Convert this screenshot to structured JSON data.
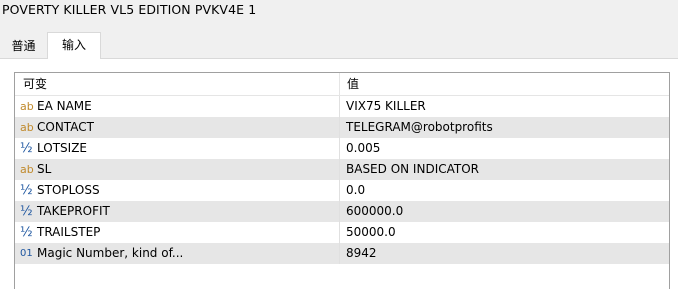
{
  "window": {
    "title": "POVERTY KILLER VL5 EDITION PVKV4E 1"
  },
  "tabs": [
    {
      "label": "普通",
      "active": false
    },
    {
      "label": "输入",
      "active": true
    }
  ],
  "table": {
    "headers": {
      "variable": "可变",
      "value": "值"
    },
    "rows": [
      {
        "icon": "ab",
        "icon_name": "string-type-icon",
        "name": "EA NAME",
        "value": "VIX75 KILLER"
      },
      {
        "icon": "ab",
        "icon_name": "string-type-icon",
        "name": "CONTACT",
        "value": "TELEGRAM@robotprofits"
      },
      {
        "icon": "½",
        "icon_name": "double-type-icon",
        "name": "LOTSIZE",
        "value": "0.005"
      },
      {
        "icon": "ab",
        "icon_name": "string-type-icon",
        "name": "SL",
        "value": "BASED ON INDICATOR"
      },
      {
        "icon": "½",
        "icon_name": "double-type-icon",
        "name": "STOPLOSS",
        "value": "0.0"
      },
      {
        "icon": "½",
        "icon_name": "double-type-icon",
        "name": "TAKEPROFIT",
        "value": "600000.0"
      },
      {
        "icon": "½",
        "icon_name": "double-type-icon",
        "name": "TRAILSTEP",
        "value": "50000.0"
      },
      {
        "icon": "01",
        "icon_name": "integer-type-icon",
        "name": "Magic Number, kind of...",
        "value": "8942"
      }
    ]
  },
  "colors": {
    "string_icon": "#c08a2c",
    "numeric_icon": "#1e56a0",
    "alt_row": "#e6e6e6"
  }
}
